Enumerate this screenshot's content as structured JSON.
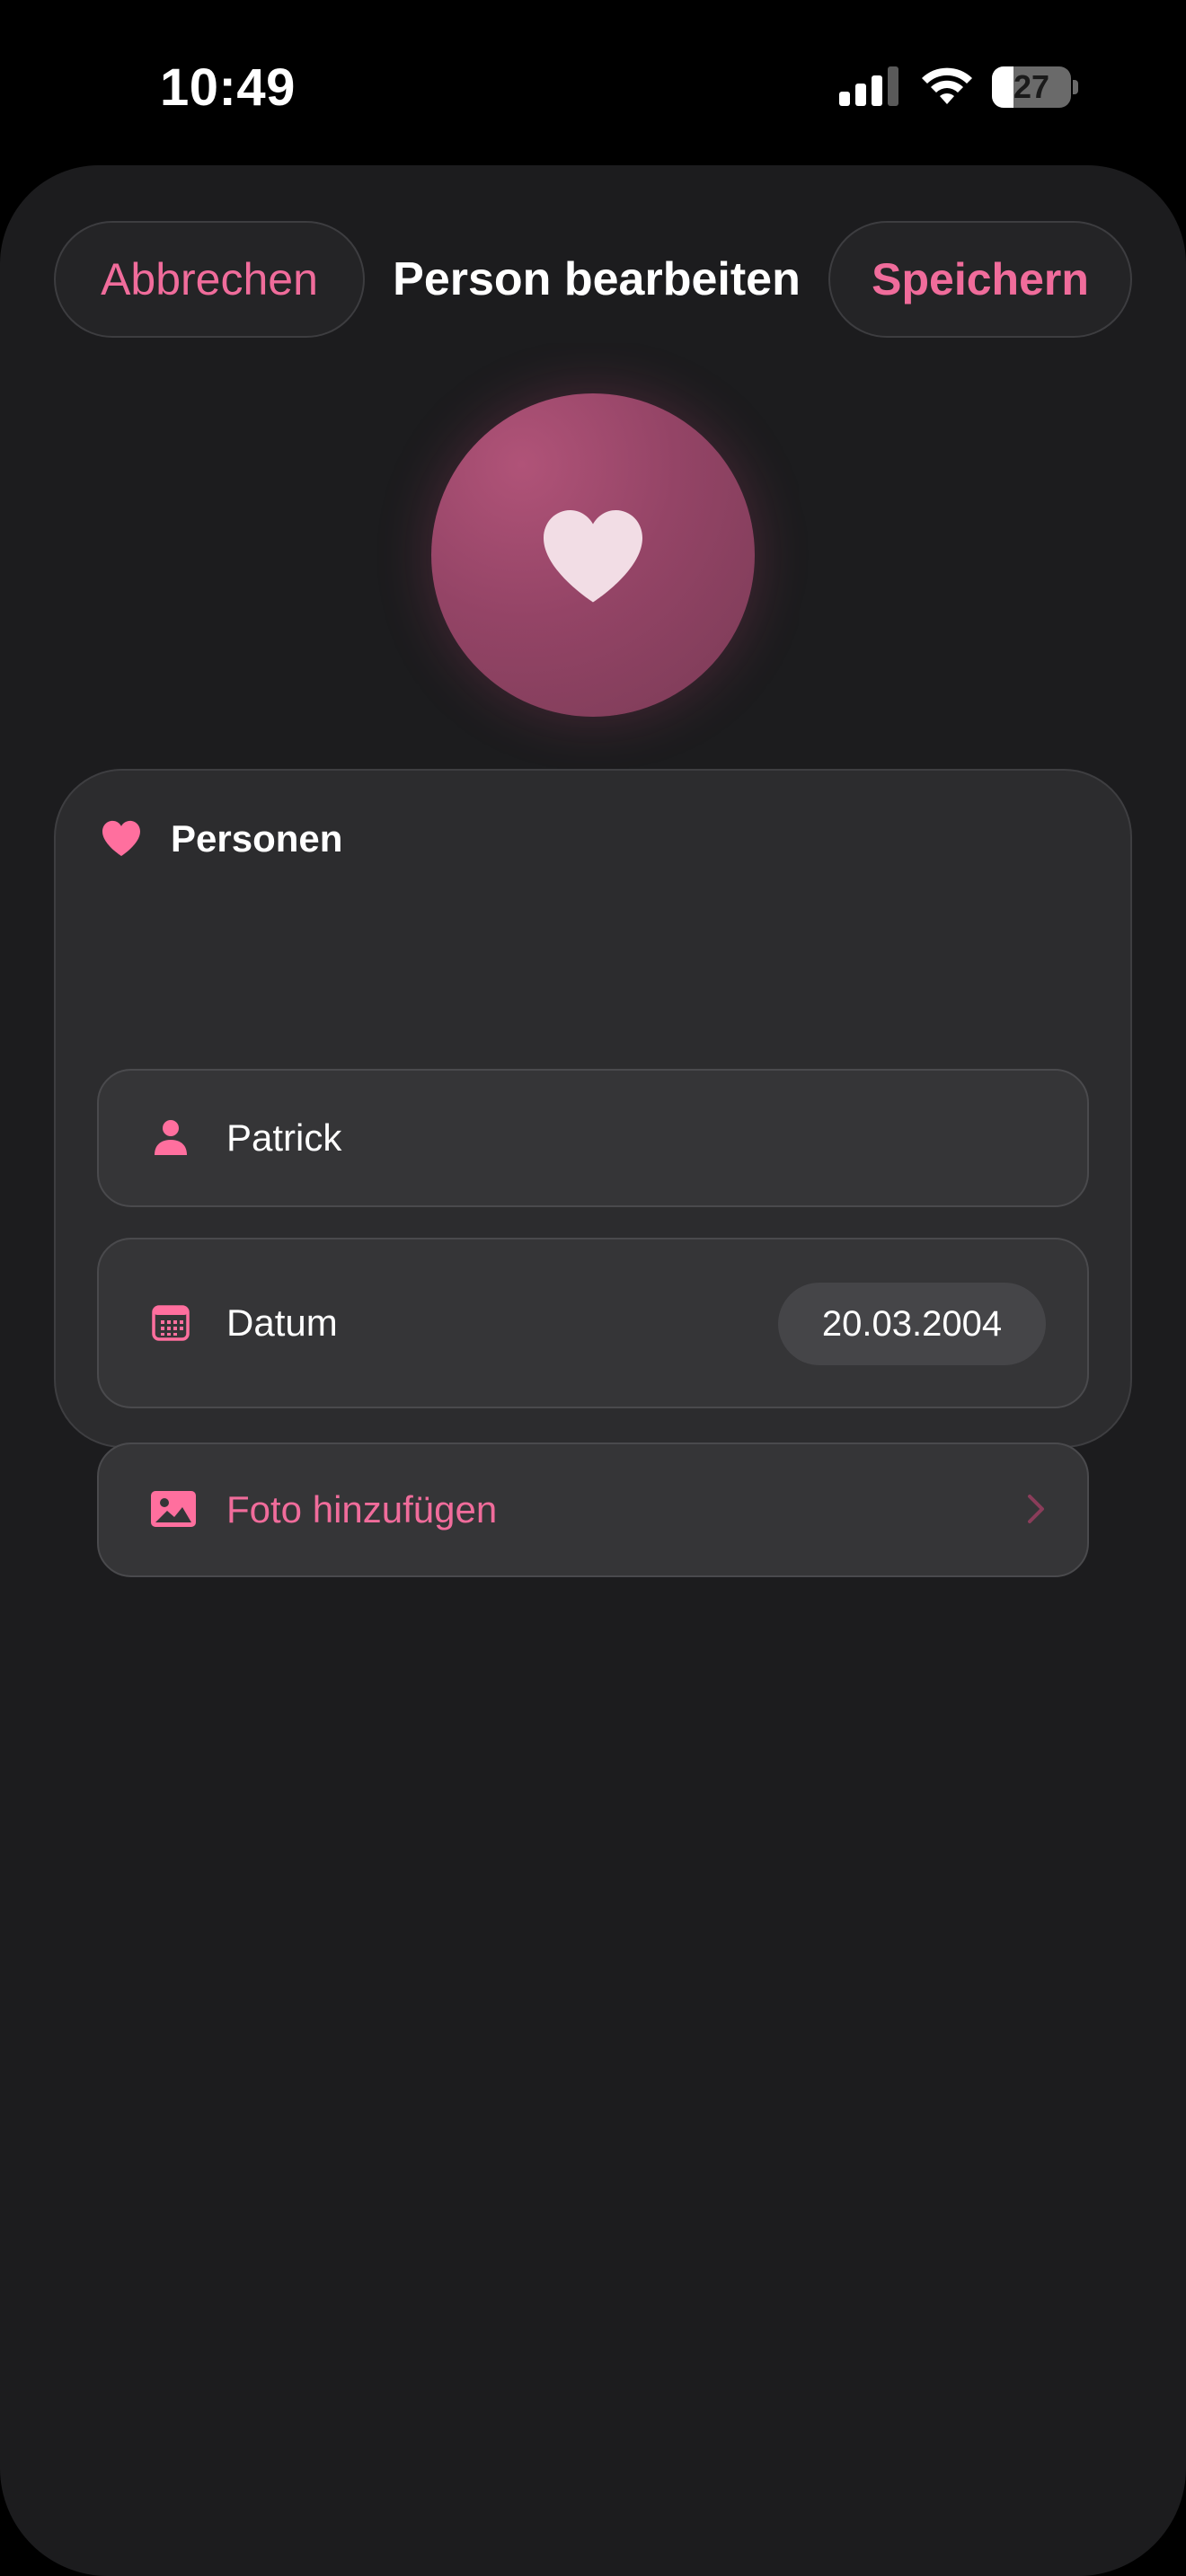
{
  "status_bar": {
    "time": "10:49",
    "battery_level": "27",
    "battery_fraction": 0.27,
    "icons": [
      "cellular-signal-icon",
      "wifi-icon",
      "battery-icon"
    ]
  },
  "nav": {
    "cancel_label": "Abbrechen",
    "title": "Person bearbeiten",
    "save_label": "Speichern"
  },
  "avatar": {
    "icon": "heart-icon"
  },
  "card": {
    "header_icon": "heart-icon",
    "title": "Personen",
    "name_row": {
      "icon": "person-icon",
      "value": "Patrick"
    },
    "date_row": {
      "icon": "calendar-icon",
      "label": "Datum",
      "value": "20.03.2004"
    },
    "photo_row": {
      "icon": "photo-icon",
      "label": "Foto hinzufügen",
      "trailing_icon": "chevron-right-icon"
    }
  },
  "colors": {
    "accent": "#f06c9b",
    "sheet_background": "#1c1c1e",
    "card_background": "#2c2c2e",
    "row_background": "#353537",
    "avatar": "#944466"
  }
}
